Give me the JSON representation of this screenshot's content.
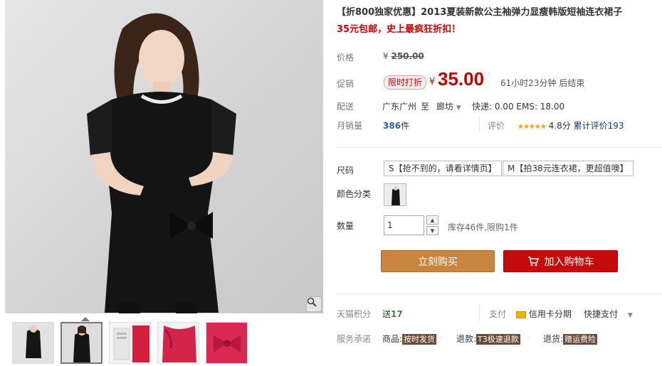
{
  "product": {
    "title": "【折800独家优惠】2013夏装新款公主袖弹力显瘦韩版短袖连衣裙子",
    "subtitle": "35元包邮，史上最疯狂折扣！"
  },
  "price": {
    "label": "价格",
    "currency": "¥",
    "original": "250.00"
  },
  "promo": {
    "label": "促销",
    "tag": "限时打折",
    "currency": "¥",
    "price": "35.00",
    "countdown": "61小时23分钟 后结束"
  },
  "delivery": {
    "label": "配送",
    "from": "广东广州",
    "to_word": "至",
    "to": "廊坊",
    "fees": "快递: 0.00 EMS: 18.00"
  },
  "sales": {
    "label": "月销量",
    "count": "386",
    "unit": "件",
    "rating_label": "评价",
    "stars": "★★★★★",
    "score": "4.8分",
    "total_reviews": "累计评价193"
  },
  "sku": {
    "size_label": "尺码",
    "sizes": [
      "S【抢不到的，请看详情页】",
      "M【拍38元连衣裙，更超值噢】"
    ],
    "color_label": "颜色分类",
    "qty_label": "数量",
    "qty_value": "1",
    "stock": "库存46件,限购1件"
  },
  "actions": {
    "buy_now": "立刻购买",
    "add_cart": "加入购物车"
  },
  "points": {
    "label": "天猫积分",
    "prefix": "送",
    "value": "17",
    "pay_label": "支付",
    "credit": "信用卡分期",
    "quick_pay": "快捷支付"
  },
  "service": {
    "label": "服务承诺",
    "items": [
      {
        "name": "商品:",
        "tag": "按时发货"
      },
      {
        "name": "退款:",
        "tag": "T3极速退款"
      },
      {
        "name": "退货:",
        "tag": "赠运费险"
      }
    ]
  },
  "colors": {
    "accent_red": "#c40000",
    "buy_orange": "#c9843f",
    "cart_red": "#c40c0c"
  }
}
